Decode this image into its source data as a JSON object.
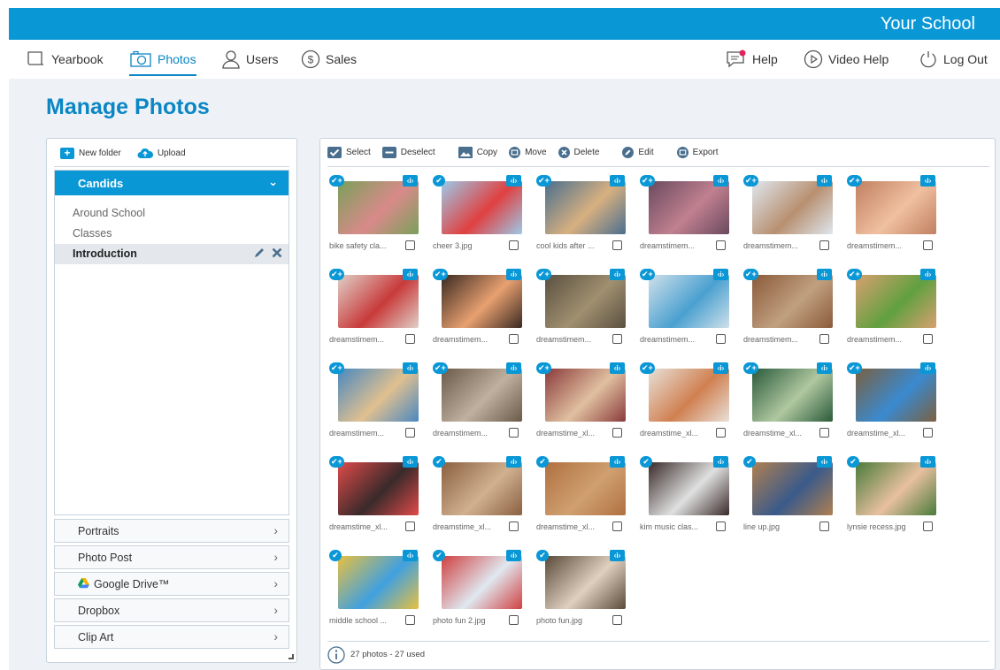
{
  "header": {
    "school_name": "Your School"
  },
  "nav": {
    "yearbook": "Yearbook",
    "photos": "Photos",
    "users": "Users",
    "sales": "Sales",
    "help": "Help",
    "video_help": "Video Help",
    "logout": "Log Out"
  },
  "page": {
    "title": "Manage Photos"
  },
  "left_panel": {
    "new_folder": "New folder",
    "upload": "Upload",
    "active_group": "Candids",
    "subfolders": [
      "Around School",
      "Classes",
      "Introduction"
    ],
    "selected_subfolder": "Introduction",
    "sections": [
      "Portraits",
      "Photo Post",
      "Google Drive™",
      "Dropbox",
      "Clip Art"
    ]
  },
  "toolbar": {
    "select": "Select",
    "deselect": "Deselect",
    "copy": "Copy",
    "move": "Move",
    "delete": "Delete",
    "edit": "Edit",
    "export": "Export"
  },
  "photos": [
    {
      "caption": "bike safety cla...",
      "badge": "✔+",
      "colors": [
        "#7aa05a",
        "#d98a8a"
      ]
    },
    {
      "caption": "cheer 3.jpg",
      "badge": "✔",
      "colors": [
        "#9cc9e8",
        "#e04040"
      ]
    },
    {
      "caption": "cool kids after ...",
      "badge": "✔+",
      "colors": [
        "#4a6f8e",
        "#d8b080"
      ]
    },
    {
      "caption": "dreamstimem...",
      "badge": "✔+",
      "colors": [
        "#6a4a5e",
        "#c08090"
      ]
    },
    {
      "caption": "dreamstimem...",
      "badge": "✔+",
      "colors": [
        "#dfe6ee",
        "#b89070"
      ]
    },
    {
      "caption": "dreamstimem...",
      "badge": "✔+",
      "colors": [
        "#c08060",
        "#f0c0a0"
      ]
    },
    {
      "caption": "dreamstimem...",
      "badge": "✔+",
      "colors": [
        "#e0d0c8",
        "#c83a3a"
      ]
    },
    {
      "caption": "dreamstimem...",
      "badge": "✔+",
      "colors": [
        "#3a2a22",
        "#e8a070"
      ]
    },
    {
      "caption": "dreamstimem...",
      "badge": "✔+",
      "colors": [
        "#5a5040",
        "#a09070"
      ]
    },
    {
      "caption": "dreamstimem...",
      "badge": "✔+",
      "colors": [
        "#cfe0ea",
        "#4aa0d0"
      ]
    },
    {
      "caption": "dreamstimem...",
      "badge": "✔+",
      "colors": [
        "#8a5a3a",
        "#c0a080"
      ]
    },
    {
      "caption": "dreamstimem...",
      "badge": "✔+",
      "colors": [
        "#d8a070",
        "#60a040"
      ]
    },
    {
      "caption": "dreamstimem...",
      "badge": "✔+",
      "colors": [
        "#4a88c0",
        "#e0c090"
      ]
    },
    {
      "caption": "dreamstimem...",
      "badge": "✔+",
      "colors": [
        "#6a5a4a",
        "#c0b0a0"
      ]
    },
    {
      "caption": "dreamstime_xl...",
      "badge": "✔+",
      "colors": [
        "#8a3a3a",
        "#e0c0a0"
      ]
    },
    {
      "caption": "dreamstime_xl...",
      "badge": "✔+",
      "colors": [
        "#e8e0d8",
        "#d08050"
      ]
    },
    {
      "caption": "dreamstime_xl...",
      "badge": "✔+",
      "colors": [
        "#2a5a3a",
        "#b0c8a0"
      ]
    },
    {
      "caption": "dreamstime_xl...",
      "badge": "✔+",
      "colors": [
        "#7a6040",
        "#3a8ad0"
      ]
    },
    {
      "caption": "dreamstime_xl...",
      "badge": "✔+",
      "colors": [
        "#e04a4a",
        "#3a2a2a"
      ]
    },
    {
      "caption": "dreamstime_xl...",
      "badge": "✔",
      "colors": [
        "#8a6040",
        "#d0b090"
      ]
    },
    {
      "caption": "dreamstime_xl...",
      "badge": "✔",
      "colors": [
        "#b07040",
        "#d0a070"
      ]
    },
    {
      "caption": "kim music clas...",
      "badge": "✔",
      "colors": [
        "#3a2a2a",
        "#e0e0e0"
      ]
    },
    {
      "caption": "line up.jpg",
      "badge": "✔",
      "colors": [
        "#b08050",
        "#3a5a8a"
      ]
    },
    {
      "caption": "lynsie recess.jpg",
      "badge": "✔",
      "colors": [
        "#4a7a3a",
        "#e8c0a0"
      ]
    },
    {
      "caption": "middle school ...",
      "badge": "✔",
      "colors": [
        "#e8c040",
        "#40a0e0"
      ]
    },
    {
      "caption": "photo fun 2.jpg",
      "badge": "✔",
      "colors": [
        "#d04040",
        "#e0e8f0"
      ]
    },
    {
      "caption": "photo fun.jpg",
      "badge": "✔",
      "colors": [
        "#5a4a3a",
        "#e0d0c0"
      ]
    }
  ],
  "status": {
    "text": "27 photos - 27 used"
  },
  "colors": {
    "primary": "#0a97d6",
    "accent": "#0a86c4",
    "panel_bg": "#eef2f6"
  },
  "icons": {
    "info_badge": "‹i›"
  }
}
